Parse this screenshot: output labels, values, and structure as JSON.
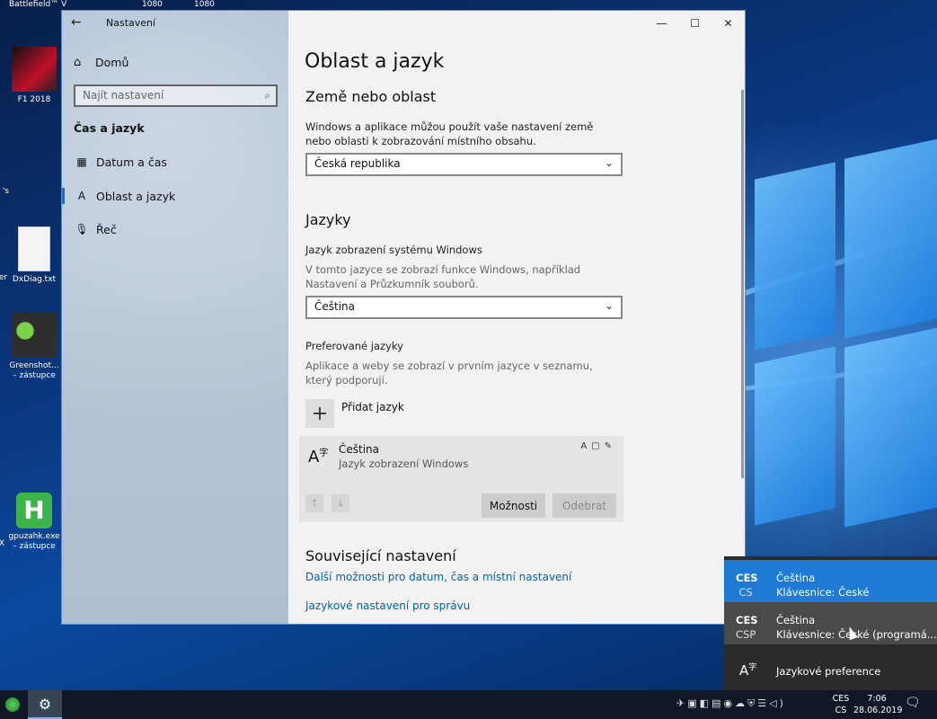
{
  "desktop": {
    "top_labels": [
      "Battlefield™ V",
      "1080",
      "1080"
    ],
    "icons": [
      {
        "label": "F1 2018",
        "sub": ""
      },
      {
        "label": "DxDiag.txt",
        "sub": ""
      },
      {
        "label": "Greenshot...",
        "sub": "– zástupce"
      },
      {
        "label": "gpuzahk.exe",
        "sub": "– zástupce"
      }
    ],
    "edge_labels": [
      "'s",
      "er",
      "X"
    ]
  },
  "settings_window": {
    "title": "Nastavení",
    "controls": {
      "minimize": "—",
      "maximize": "☐",
      "close": "✕"
    },
    "sidebar": {
      "home": "Domů",
      "search_placeholder": "Najít nastavení",
      "section": "Čas a jazyk",
      "items": [
        {
          "label": "Datum a čas",
          "icon": "calendar-icon"
        },
        {
          "label": "Oblast a jazyk",
          "icon": "language-icon"
        },
        {
          "label": "Řeč",
          "icon": "microphone-icon"
        }
      ]
    },
    "page": {
      "title": "Oblast a jazyk",
      "country_section": {
        "heading": "Země nebo oblast",
        "description": "Windows a aplikace můžou použít vaše nastavení země nebo oblasti k zobrazování místního obsahu.",
        "selected": "Česká republika"
      },
      "languages_section": {
        "heading": "Jazyky",
        "display_label": "Jazyk zobrazení systému Windows",
        "display_description": "V tomto jazyce se zobrazí funkce Windows, například Nastavení a Průzkumník souborů.",
        "display_selected": "Čeština",
        "preferred_label": "Preferované jazyky",
        "preferred_description": "Aplikace a weby se zobrazí v prvním jazyce v seznamu, který podporují.",
        "add_language": "Přidat jazyk",
        "language_card": {
          "name": "Čeština",
          "subtitle": "Jazyk zobrazení Windows",
          "options_button": "Možnosti",
          "remove_button": "Odebrat"
        }
      },
      "related": {
        "heading": "Související nastavení",
        "links": [
          "Další možnosti pro datum, čas a místní nastavení",
          "Jazykové nastavení pro správu"
        ]
      }
    }
  },
  "language_flyout": {
    "items": [
      {
        "code": "CES",
        "sub_code": "CS",
        "language": "Čeština",
        "keyboard": "Klávesnice: České",
        "state": "selected"
      },
      {
        "code": "CES",
        "sub_code": "CSP",
        "language": "Čeština",
        "keyboard": "Klávesnice: České (programá...",
        "state": "hover"
      }
    ],
    "preferences": "Jazykové preference"
  },
  "taskbar": {
    "lang_code": "CES",
    "lang_sub": "CS",
    "time": "7:06",
    "date": "28.06.2019"
  },
  "colors": {
    "accent": "#1f7ad6",
    "link": "#0063b1",
    "flyout_bg": "#2b2b2b",
    "taskbar_bg": "#101828"
  }
}
